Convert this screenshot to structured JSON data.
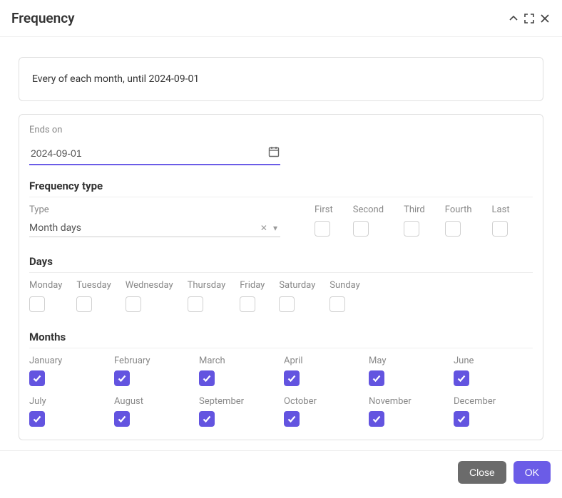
{
  "header": {
    "title": "Frequency"
  },
  "summary": {
    "text": "Every   of each month, until 2024-09-01"
  },
  "ends_on": {
    "label": "Ends on",
    "value": "2024-09-01"
  },
  "freq_type": {
    "title": "Frequency type",
    "type_label": "Type",
    "type_value": "Month days",
    "ordinals": {
      "first": {
        "label": "First",
        "checked": false
      },
      "second": {
        "label": "Second",
        "checked": false
      },
      "third": {
        "label": "Third",
        "checked": false
      },
      "fourth": {
        "label": "Fourth",
        "checked": false
      },
      "last": {
        "label": "Last",
        "checked": false
      }
    }
  },
  "days": {
    "title": "Days",
    "items": {
      "mon": {
        "label": "Monday",
        "checked": false
      },
      "tue": {
        "label": "Tuesday",
        "checked": false
      },
      "wed": {
        "label": "Wednesday",
        "checked": false
      },
      "thu": {
        "label": "Thursday",
        "checked": false
      },
      "fri": {
        "label": "Friday",
        "checked": false
      },
      "sat": {
        "label": "Saturday",
        "checked": false
      },
      "sun": {
        "label": "Sunday",
        "checked": false
      }
    }
  },
  "months": {
    "title": "Months",
    "items": {
      "jan": {
        "label": "January",
        "checked": true
      },
      "feb": {
        "label": "February",
        "checked": true
      },
      "mar": {
        "label": "March",
        "checked": true
      },
      "apr": {
        "label": "April",
        "checked": true
      },
      "may": {
        "label": "May",
        "checked": true
      },
      "jun": {
        "label": "June",
        "checked": true
      },
      "jul": {
        "label": "July",
        "checked": true
      },
      "aug": {
        "label": "August",
        "checked": true
      },
      "sep": {
        "label": "September",
        "checked": true
      },
      "oct": {
        "label": "October",
        "checked": true
      },
      "nov": {
        "label": "November",
        "checked": true
      },
      "dec": {
        "label": "December",
        "checked": true
      }
    }
  },
  "footer": {
    "close": "Close",
    "ok": "OK"
  },
  "colors": {
    "accent": "#6b5ce7"
  }
}
